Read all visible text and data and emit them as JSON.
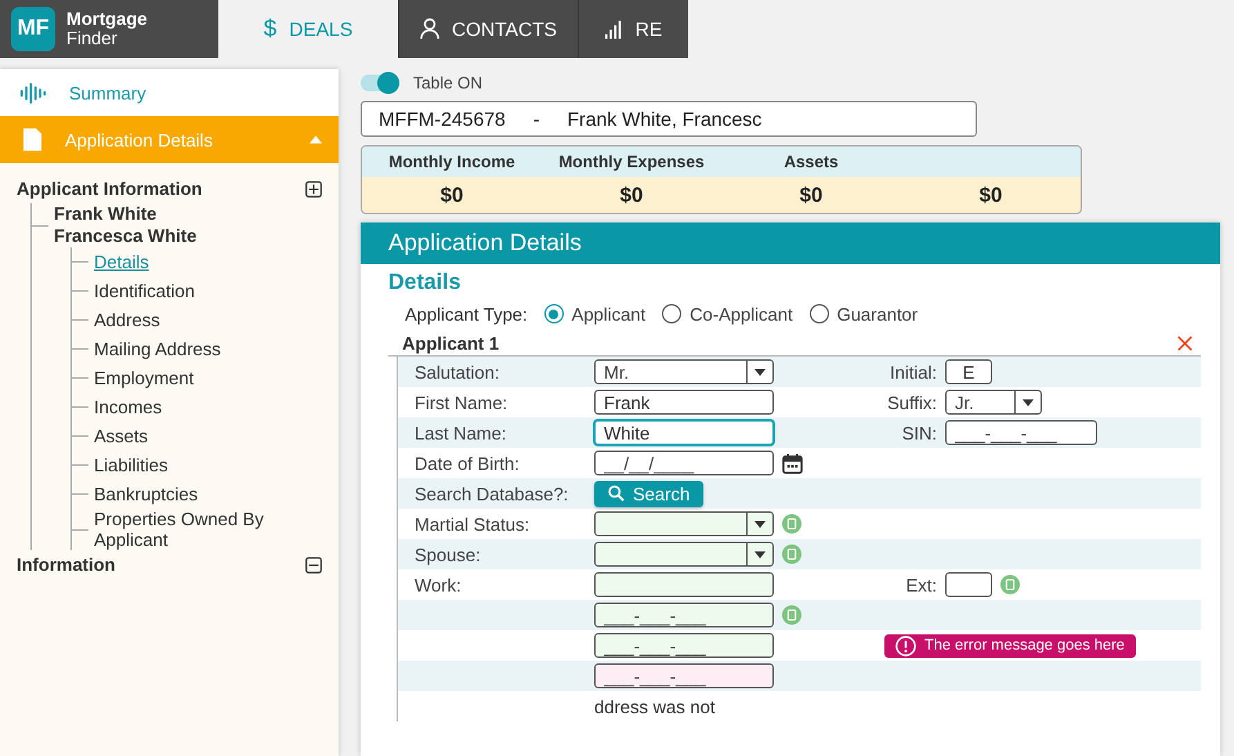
{
  "logo": {
    "mark": "MF",
    "name": "Mortgage",
    "subname": "Finder"
  },
  "nav_tabs": [
    {
      "label": "DEALS",
      "icon_glyph": "$",
      "selected": true
    },
    {
      "label": "CONTACTS",
      "selected": false
    },
    {
      "label": "RE",
      "selected": false
    }
  ],
  "sidebar": {
    "summary": {
      "label": "Summary"
    },
    "section": {
      "label": "Application Details",
      "expanded": true
    },
    "tree": [
      {
        "label": "Applicant Information",
        "expanded": false,
        "children": [
          {
            "names": [
              "Frank White",
              "Francesca White"
            ],
            "children": [
              {
                "label": "Details",
                "selected": true
              },
              {
                "label": "Identification",
                "selected": false
              },
              {
                "label": "Address",
                "selected": false
              },
              {
                "label": "Mailing Address",
                "selected": false
              },
              {
                "label": "Employment",
                "selected": false
              },
              {
                "label": "Incomes",
                "selected": false
              },
              {
                "label": "Assets",
                "selected": false
              },
              {
                "label": "Liabilities",
                "selected": false
              },
              {
                "label": "Bankruptcies",
                "selected": false
              },
              {
                "label": "Properties Owned By Applicant",
                "selected": false
              }
            ]
          }
        ]
      },
      {
        "label": "Information",
        "expanded": true
      }
    ]
  },
  "table_toggle": {
    "label": "Table ON",
    "on": true
  },
  "deal_line": {
    "number": "MFFM-245678",
    "separator": "-",
    "applicants": "Frank White, Francesc"
  },
  "summary_table": {
    "columns": [
      "Monthly Income",
      "Monthly Expenses",
      "Assets"
    ],
    "values": [
      "$0",
      "$0",
      "$0",
      "$0"
    ]
  },
  "panel": {
    "title": "Application Details",
    "heading": "Details",
    "applicant_type": {
      "label": "Applicant Type:",
      "options": [
        {
          "label": "Applicant",
          "selected": true
        },
        {
          "label": "Co-Applicant",
          "selected": false
        },
        {
          "label": "Guarantor",
          "selected": false
        }
      ]
    },
    "legend": "Applicant 1",
    "rows": [
      {
        "label": "Salutation:",
        "field": {
          "kind": "select",
          "value": "Mr."
        },
        "side": {
          "label": "Initial:",
          "field": {
            "kind": "text",
            "value": "E"
          }
        }
      },
      {
        "label": "First Name:",
        "field": {
          "kind": "text",
          "value": "Frank"
        },
        "side": {
          "label": "Suffix:",
          "field": {
            "kind": "select",
            "value": "Jr."
          }
        }
      },
      {
        "label": "Last Name:",
        "field": {
          "kind": "text",
          "value": "White",
          "focused": true
        },
        "side": {
          "label": "SIN:",
          "field": {
            "kind": "masked",
            "placeholder": "___-___-___"
          }
        }
      },
      {
        "label": "Date of Birth:",
        "field": {
          "kind": "masked",
          "placeholder": "__/__/____",
          "calendar": true
        }
      },
      {
        "label": "Search Database?:",
        "field": {
          "kind": "button",
          "label": "Search"
        }
      },
      {
        "label": "Martial Status:",
        "field": {
          "kind": "select",
          "verified": true,
          "copy": true
        }
      },
      {
        "label": "Spouse:",
        "field": {
          "kind": "select",
          "verified": true,
          "copy": true
        }
      },
      {
        "label": "Work:",
        "field": {
          "kind": "text",
          "verified": true
        },
        "side": {
          "label": "Ext:",
          "field": {
            "kind": "text",
            "copy": true
          }
        }
      },
      {
        "field": {
          "kind": "masked",
          "placeholder": "___-___-___",
          "verified": true,
          "copy": true
        }
      },
      {
        "field": {
          "kind": "masked",
          "placeholder": "___-___-___",
          "verified": true
        },
        "error": "The error message goes here"
      },
      {
        "field": {
          "kind": "masked",
          "placeholder": "___-___-___",
          "invalid": true
        }
      },
      {
        "note": "ddress was not"
      }
    ]
  }
}
